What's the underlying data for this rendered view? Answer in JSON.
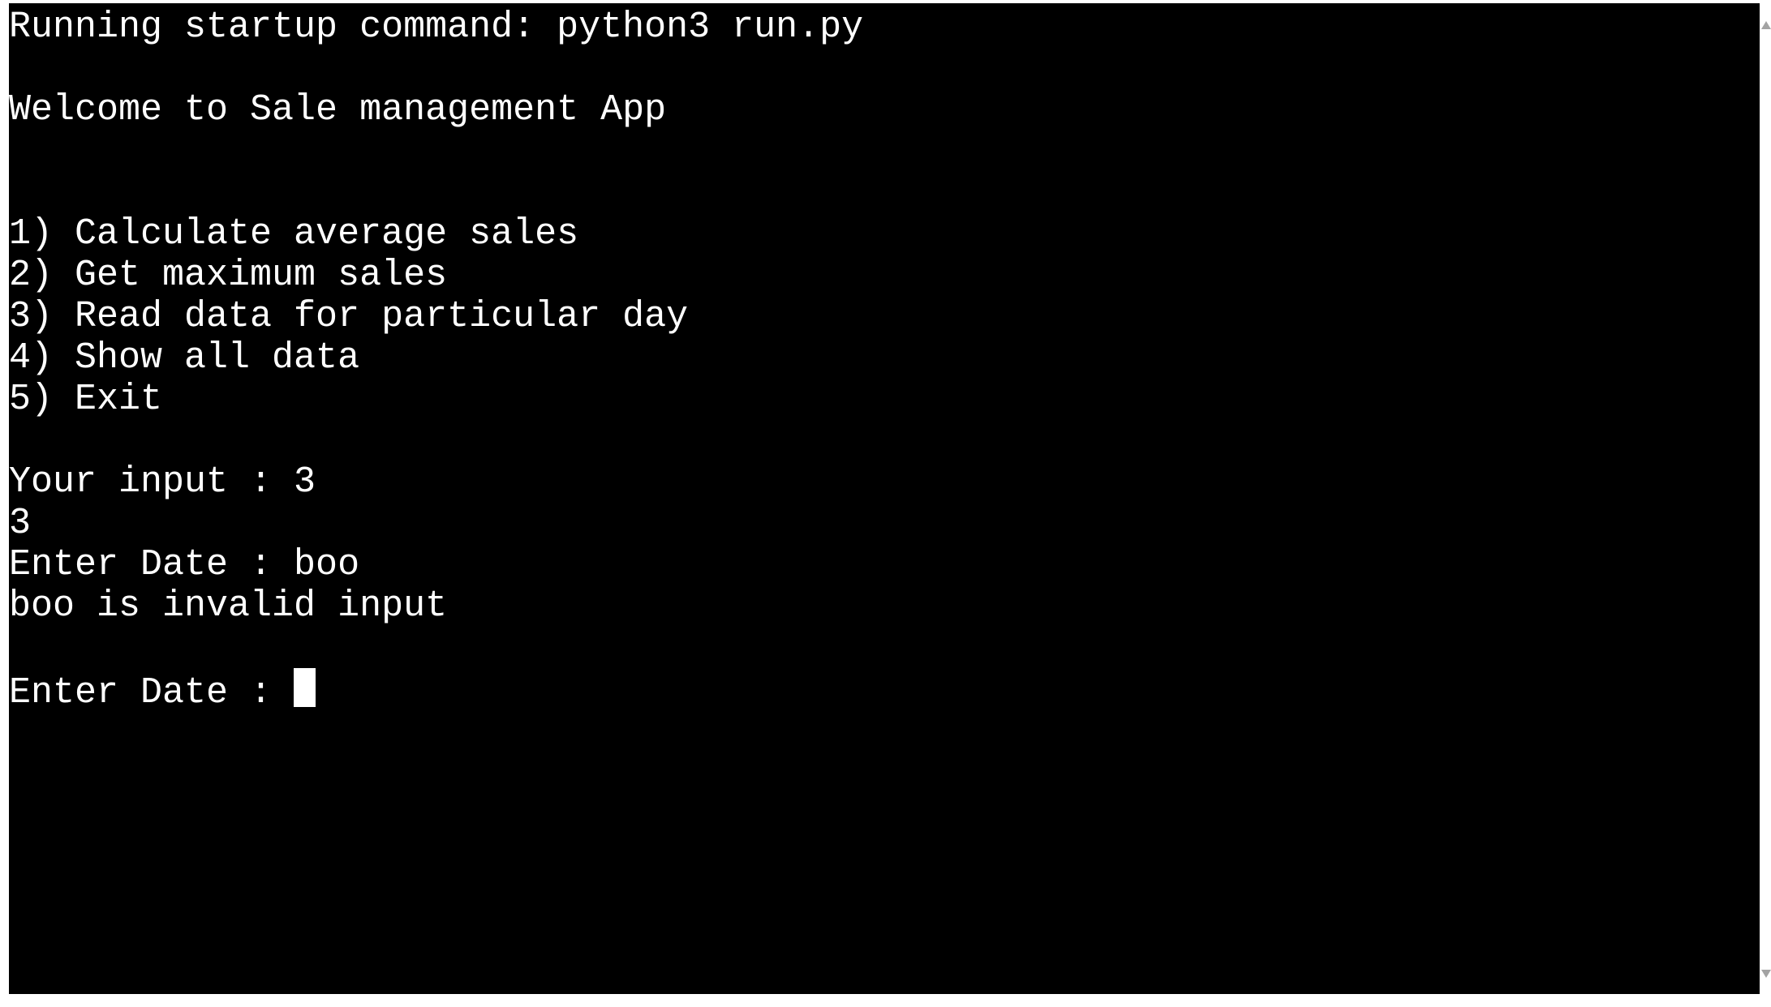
{
  "terminal": {
    "startup_line": "Running startup command: python3 run.py",
    "welcome_line": "Welcome to Sale management App",
    "menu": [
      "1) Calculate average sales",
      "2) Get maximum sales",
      "3) Read data for particular day",
      "4) Show all data",
      "5) Exit"
    ],
    "input_prompt_line": "Your input : 3",
    "echo_line": "3",
    "date_prompt_line": "Enter Date : boo",
    "error_line": "boo is invalid input",
    "current_prompt": "Enter Date : "
  },
  "colors": {
    "terminal_background": "#000000",
    "terminal_text": "#ffffff",
    "scroll_arrow": "#a3a3a3"
  },
  "icons": {
    "scroll_up": "scroll-up-arrow-icon",
    "scroll_down": "scroll-down-arrow-icon"
  }
}
